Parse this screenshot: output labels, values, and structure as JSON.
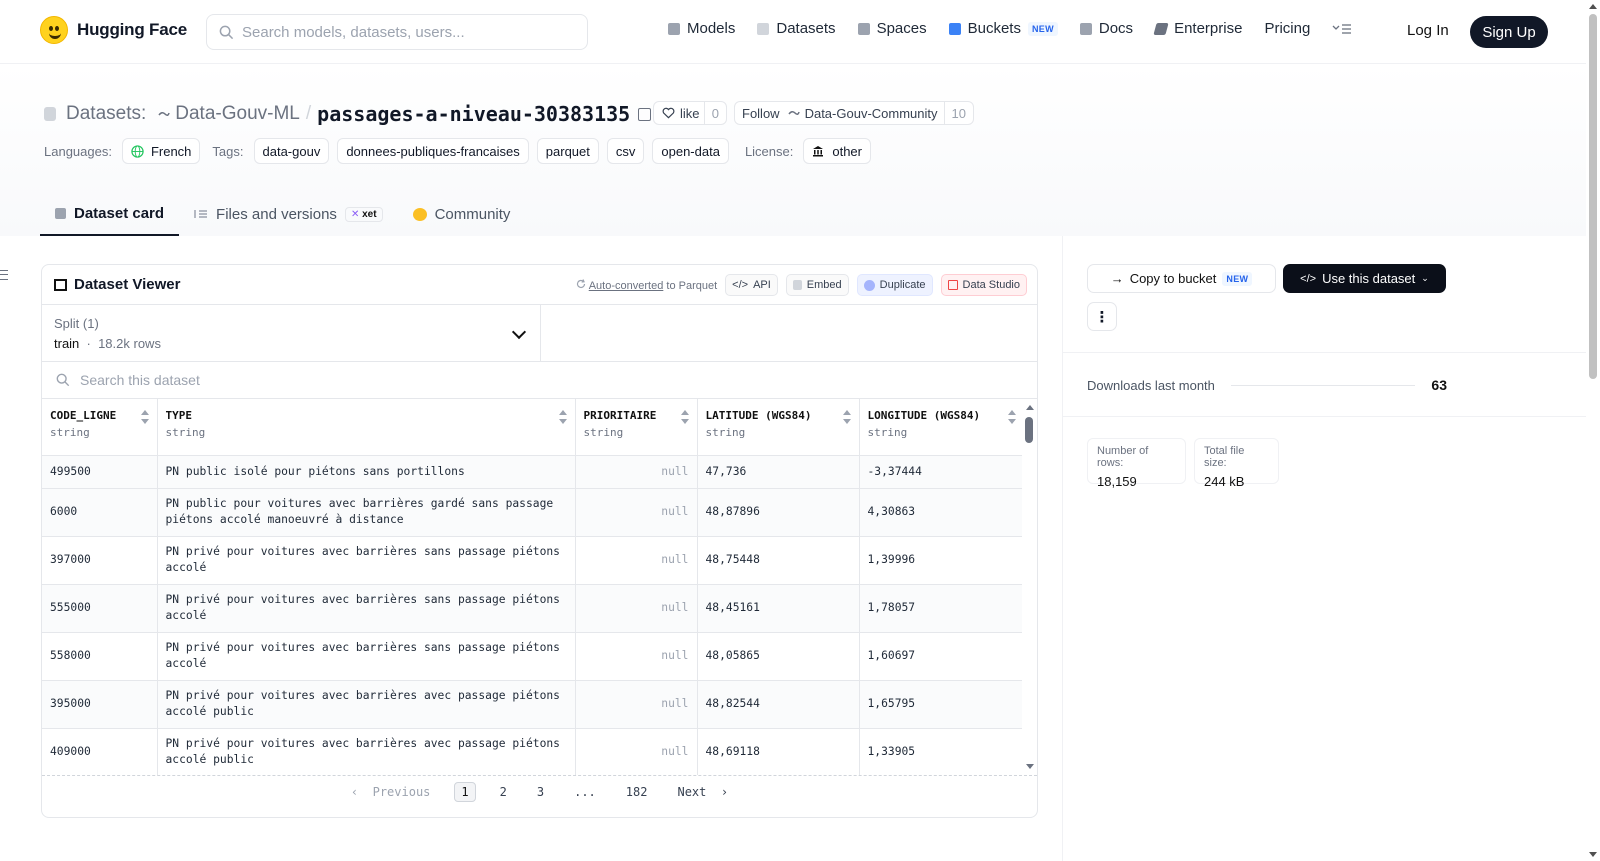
{
  "header": {
    "brand": "Hugging Face",
    "search_placeholder": "Search models, datasets, users...",
    "nav": [
      {
        "label": "Models",
        "color": "#6b7280"
      },
      {
        "label": "Datasets",
        "color": "#9ca3af"
      },
      {
        "label": "Spaces",
        "color": "#6b7280"
      },
      {
        "label": "Buckets",
        "color": "#3b82f6",
        "badge": "NEW"
      },
      {
        "label": "Docs",
        "color": "#6b7280"
      },
      {
        "label": "Enterprise",
        "color": "#6b7280"
      },
      {
        "label": "Pricing"
      }
    ],
    "login": "Log In",
    "signup": "Sign Up"
  },
  "dataset": {
    "label": "Datasets:",
    "org": "Data-Gouv-ML",
    "name": "passages-a-niveau-30383135",
    "like_label": "like",
    "like_count": "0",
    "follow_label": "Follow",
    "follow_org": "Data-Gouv-Community",
    "follow_count": "10",
    "languages_label": "Languages:",
    "language": "French",
    "tags_label": "Tags:",
    "tags": [
      "data-gouv",
      "donnees-publiques-francaises",
      "parquet",
      "csv",
      "open-data"
    ],
    "license_label": "License:",
    "license": "other"
  },
  "tabs": [
    {
      "label": "Dataset card",
      "active": true
    },
    {
      "label": "Files and versions",
      "badge": "xet"
    },
    {
      "label": "Community"
    }
  ],
  "viewer": {
    "title": "Dataset Viewer",
    "auto_converted": "Auto-converted",
    "to_parquet": "to Parquet",
    "api": "API",
    "embed": "Embed",
    "duplicate": "Duplicate",
    "data_studio": "Data Studio",
    "split_label": "Split (1)",
    "split_name": "train",
    "split_rows": "18.2k rows",
    "search_placeholder": "Search this dataset",
    "columns": [
      {
        "name": "CODE_LIGNE",
        "type": "string"
      },
      {
        "name": "TYPE",
        "type": "string"
      },
      {
        "name": "PRIORITAIRE",
        "type": "string"
      },
      {
        "name": "LATITUDE (WGS84)",
        "type": "string"
      },
      {
        "name": "LONGITUDE (WGS84)",
        "type": "string"
      }
    ],
    "rows": [
      [
        "499500",
        "PN public isolé pour piétons sans portillons",
        "null",
        "47,736",
        "-3,37444"
      ],
      [
        "6000",
        "PN public pour voitures avec barrières gardé sans passage piétons accolé manoeuvré à distance",
        "null",
        "48,87896",
        "4,30863"
      ],
      [
        "397000",
        "PN privé pour voitures avec barrières sans passage piétons accolé",
        "null",
        "48,75448",
        "1,39996"
      ],
      [
        "555000",
        "PN privé pour voitures avec barrières sans passage piétons accolé",
        "null",
        "48,45161",
        "1,78057"
      ],
      [
        "558000",
        "PN privé pour voitures avec barrières sans passage piétons accolé",
        "null",
        "48,05865",
        "1,60697"
      ],
      [
        "395000",
        "PN privé pour voitures avec barrières avec passage piétons accolé public",
        "null",
        "48,82544",
        "1,65795"
      ],
      [
        "409000",
        "PN privé pour voitures avec barrières avec passage piétons accolé public",
        "null",
        "48,69118",
        "1,33905"
      ]
    ],
    "pager": {
      "previous": "Previous",
      "pages": [
        "1",
        "2",
        "3",
        "...",
        "182"
      ],
      "current": "1",
      "next": "Next"
    }
  },
  "sidebar": {
    "copy_to_bucket": "Copy to bucket",
    "copy_badge": "NEW",
    "use_dataset": "Use this dataset",
    "more": "⋮",
    "downloads_label": "Downloads last month",
    "downloads_value": "63",
    "num_rows_label": "Number of rows:",
    "num_rows_value": "18,159",
    "file_size_label": "Total file size:",
    "file_size_value": "244 kB"
  }
}
